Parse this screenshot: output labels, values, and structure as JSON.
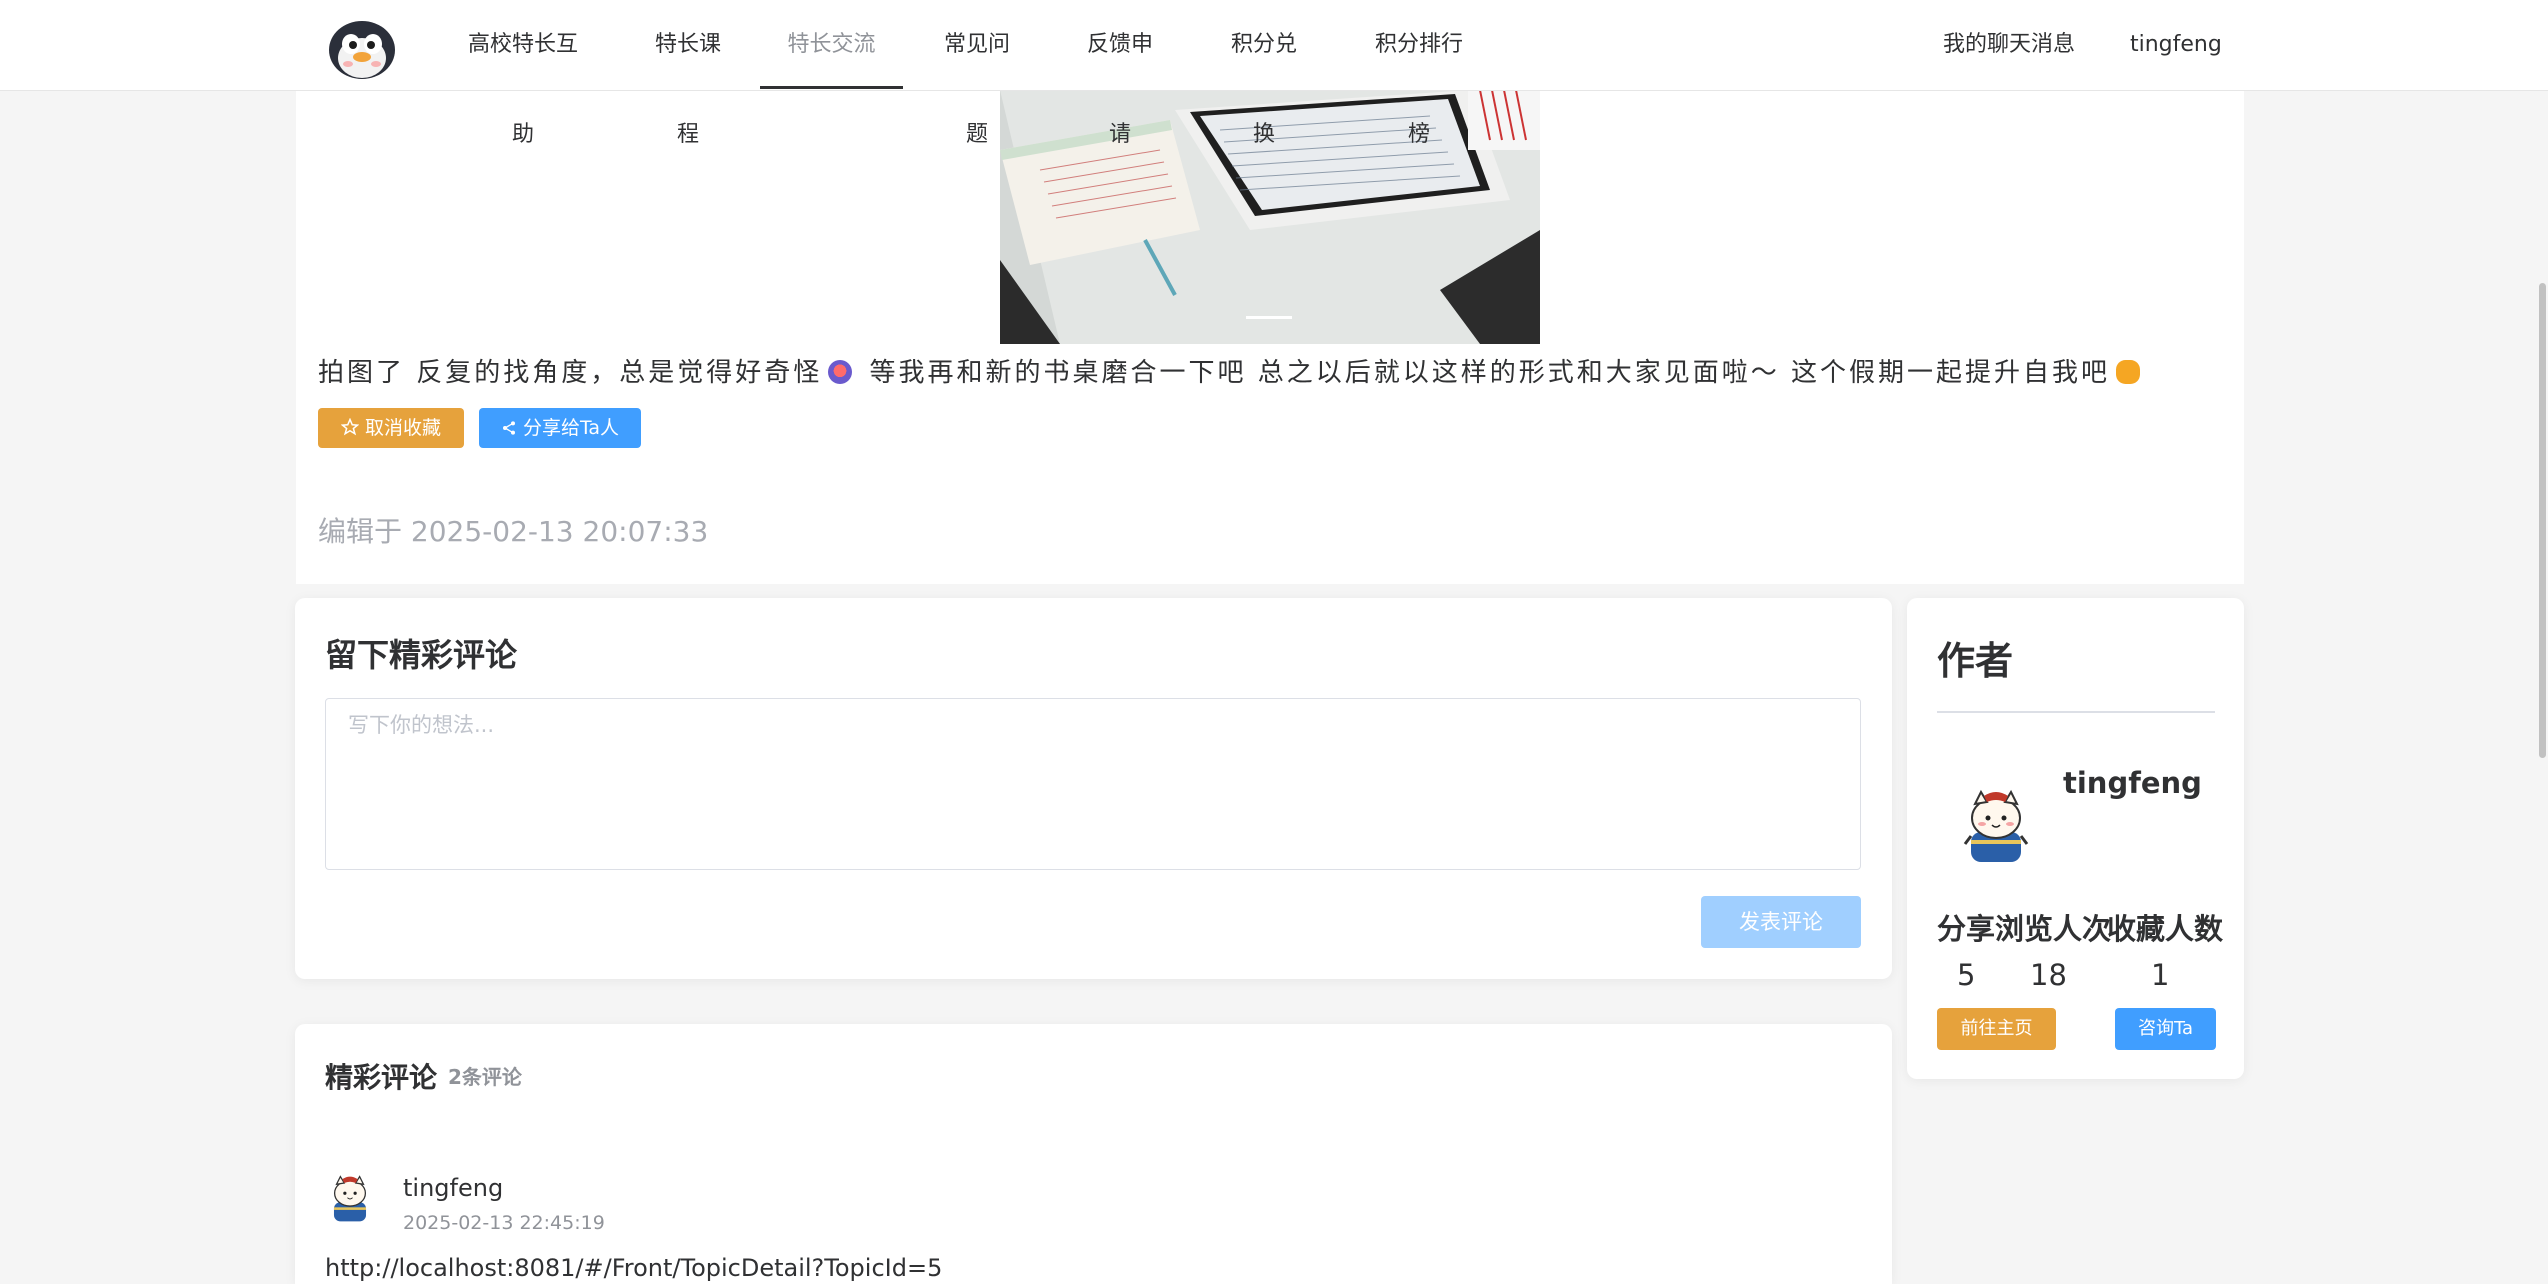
{
  "nav": {
    "items": [
      "高校特长互助",
      "特长课程",
      "特长交流",
      "常见问题",
      "反馈申请",
      "积分兑换",
      "积分排行榜"
    ],
    "active_index": 2,
    "chat": "我的聊天消息",
    "user": "tingfeng"
  },
  "post": {
    "caption_a": "拍图了 反复的找角度，总是觉得好奇怪",
    "caption_b": "等我再和新的书桌磨合一下吧 总之以后就以这样的形式和大家见面啦～ 这个假期一起提升自我吧",
    "favorite_button": "取消收藏",
    "share_button": "分享给Ta人",
    "edited": "编辑于 2025-02-13 20:07:33"
  },
  "comment_editor": {
    "title": "留下精彩评论",
    "placeholder": "写下你的想法...",
    "submit": "发表评论"
  },
  "author": {
    "title": "作者",
    "name": "tingfeng",
    "labels": [
      "分享",
      "浏览人次",
      "收藏人数"
    ],
    "values": [
      "5",
      "18",
      "1"
    ],
    "home_button": "前往主页",
    "consult_button": "咨询Ta"
  },
  "comments": {
    "title": "精彩评论",
    "count": "2条评论",
    "items": [
      {
        "user": "tingfeng",
        "time": "2025-02-13 22:45:19",
        "content": "http://localhost:8081/#/Front/TopicDetail?TopicId=5"
      }
    ]
  },
  "colors": {
    "warning": "#e6a23c",
    "primary": "#409eff",
    "primary_disabled": "#a0cfff"
  }
}
